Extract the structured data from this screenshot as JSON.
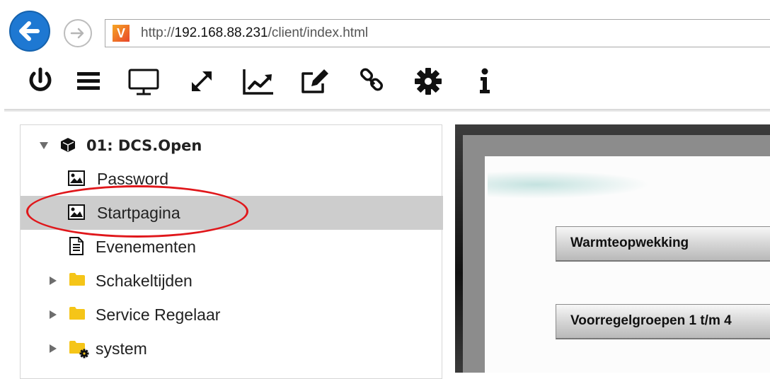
{
  "browser": {
    "url_prefix": "http://",
    "url_host": "192.168.88.231",
    "url_path": "/client/index.html",
    "favicon_letter": "V"
  },
  "toolbar": {
    "icons": [
      "power-icon",
      "menu-icon",
      "monitor-icon",
      "expand-icon",
      "chart-icon",
      "edit-icon",
      "link-icon",
      "gear-icon",
      "info-icon"
    ]
  },
  "tree": {
    "root": {
      "label": "01: DCS.Open",
      "expanded": true
    },
    "items": [
      {
        "label": "Password",
        "icon": "image-icon",
        "selected": false
      },
      {
        "label": "Startpagina",
        "icon": "image-icon",
        "selected": true
      },
      {
        "label": "Evenementen",
        "icon": "document-icon",
        "selected": false
      },
      {
        "label": "Schakeltijden",
        "icon": "folder-icon",
        "selected": false
      },
      {
        "label": "Service Regelaar",
        "icon": "folder-icon",
        "selected": false
      },
      {
        "label": "system",
        "icon": "folder-gear-icon",
        "selected": false
      }
    ]
  },
  "viewer": {
    "buttons": [
      "Warmteopwekking",
      "Voorregelgroepen 1 t/m 4"
    ]
  },
  "colors": {
    "back_button": "#1e78d2",
    "selection": "#cdcdcd",
    "highlight": "#e0171b",
    "folder": "#f5c518"
  }
}
